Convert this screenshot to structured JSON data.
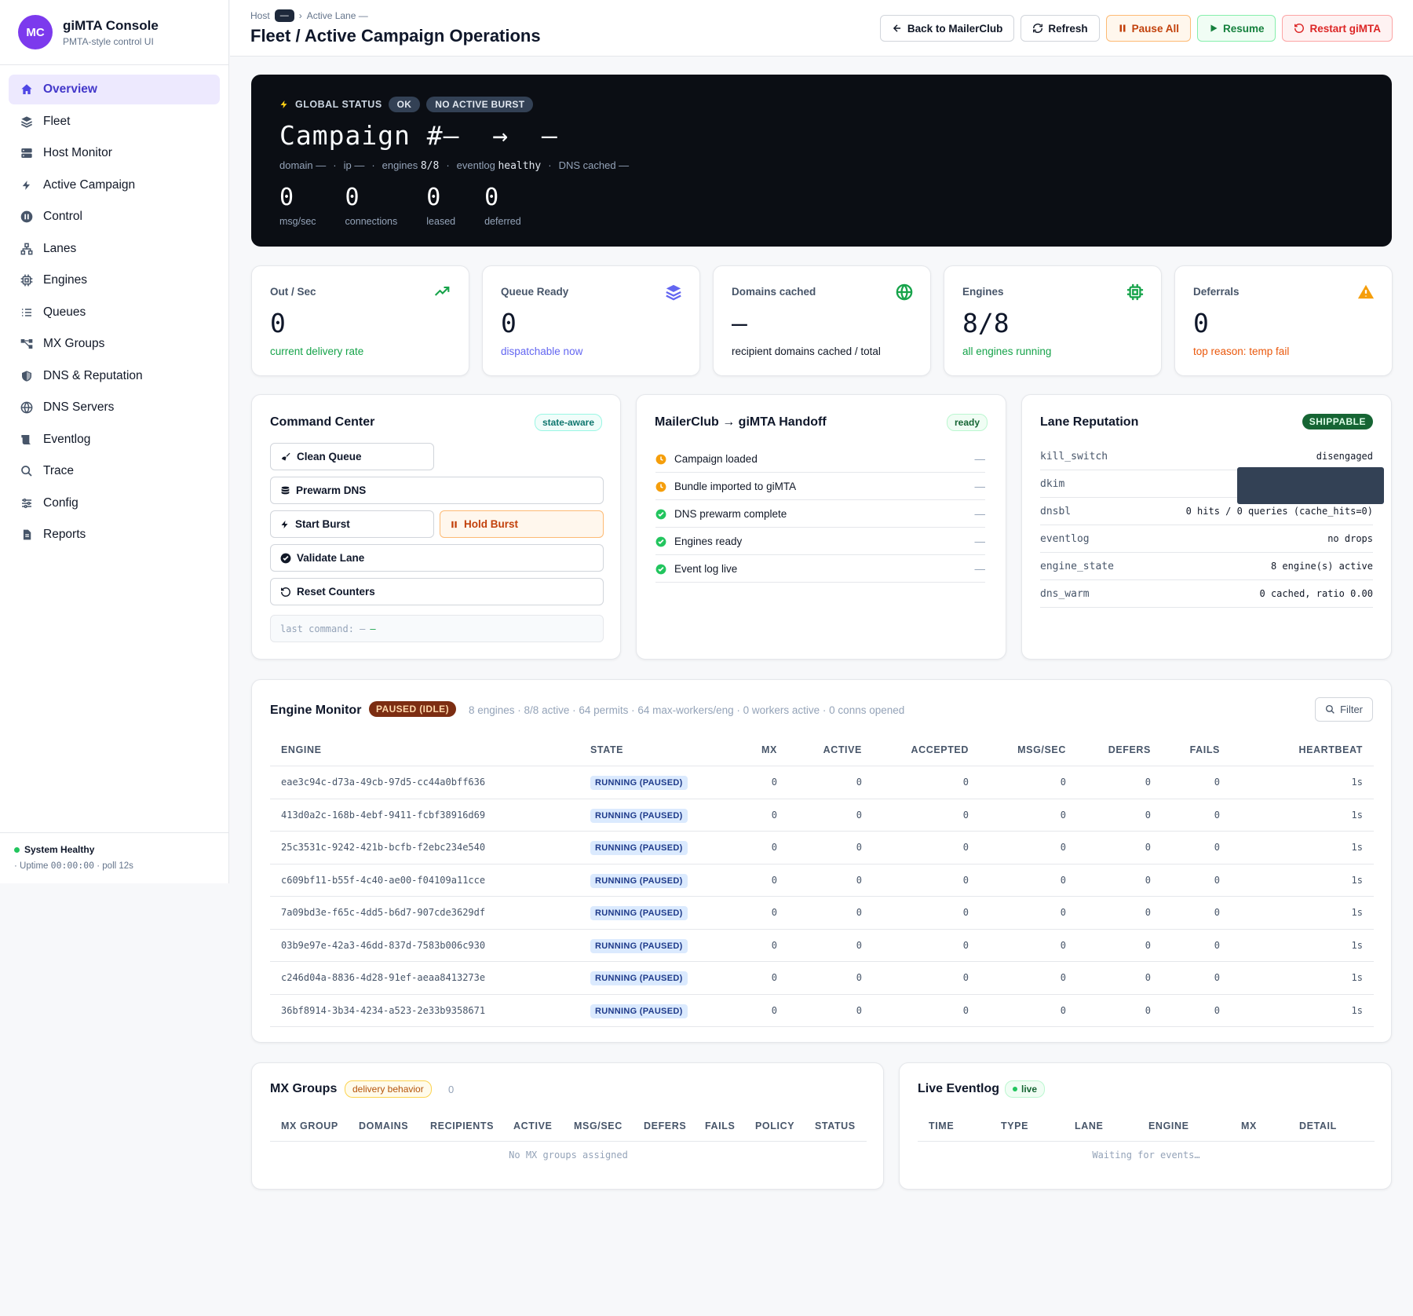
{
  "brand": {
    "initials": "MC",
    "title": "giMTA Console",
    "subtitle": "PMTA-style control UI"
  },
  "nav": [
    {
      "label": "Overview",
      "icon": "home-icon",
      "active": true
    },
    {
      "label": "Fleet",
      "icon": "layers-icon"
    },
    {
      "label": "Host Monitor",
      "icon": "server-icon"
    },
    {
      "label": "Active Campaign",
      "icon": "bolt-icon"
    },
    {
      "label": "Control",
      "icon": "pause-circle-icon"
    },
    {
      "label": "Lanes",
      "icon": "network-icon"
    },
    {
      "label": "Engines",
      "icon": "chip-icon"
    },
    {
      "label": "Queues",
      "icon": "list-icon"
    },
    {
      "label": "MX Groups",
      "icon": "share-icon"
    },
    {
      "label": "DNS & Reputation",
      "icon": "shield-icon"
    },
    {
      "label": "DNS Servers",
      "icon": "globe-icon"
    },
    {
      "label": "Eventlog",
      "icon": "scroll-icon"
    },
    {
      "label": "Trace",
      "icon": "search-icon"
    },
    {
      "label": "Config",
      "icon": "sliders-icon"
    },
    {
      "label": "Reports",
      "icon": "file-icon"
    }
  ],
  "system": {
    "status": "System Healthy",
    "uptime_prefix": "· Uptime",
    "uptime": "00:00:00",
    "poll": "· poll 12s"
  },
  "breadcrumb": {
    "host": "Host",
    "host_value": "—",
    "sep": "›",
    "lane": "Active Lane —"
  },
  "page_title": "Fleet / Active Campaign Operations",
  "actions": {
    "back": "Back to MailerClub",
    "refresh": "Refresh",
    "pause": "Pause All",
    "resume": "Resume",
    "restart": "Restart giMTA"
  },
  "hero": {
    "label": "GLOBAL STATUS",
    "status": "OK",
    "burst": "NO ACTIVE BURST",
    "title": "Campaign #—  →  —",
    "meta": {
      "domain": "domain —",
      "ip": "ip —",
      "engines_label": "engines",
      "engines": "8/8",
      "eventlog_label": "eventlog",
      "eventlog": "healthy",
      "dns": "DNS cached —"
    },
    "stats": [
      {
        "value": "0",
        "label": "msg/sec"
      },
      {
        "value": "0",
        "label": "connections"
      },
      {
        "value": "0",
        "label": "leased"
      },
      {
        "value": "0",
        "label": "deferred"
      }
    ]
  },
  "cards": [
    {
      "title": "Out / Sec",
      "value": "0",
      "sub": "current delivery rate",
      "color": "#16a34a",
      "icon": "trending-up-icon"
    },
    {
      "title": "Queue Ready",
      "value": "0",
      "sub": "dispatchable now",
      "color": "#6366f1",
      "icon": "stack-icon"
    },
    {
      "title": "Domains cached",
      "value": "—",
      "sub": "recipient domains cached / total",
      "color": "#111827",
      "icon": "globe-icon"
    },
    {
      "title": "Engines",
      "value": "8/8",
      "sub": "all engines running",
      "color": "#16a34a",
      "icon": "chip-icon"
    },
    {
      "title": "Deferrals",
      "value": "0",
      "sub": "top reason: temp fail",
      "color": "#ea580c",
      "icon": "warning-icon"
    }
  ],
  "command": {
    "title": "Command Center",
    "badge": "state-aware",
    "clean": "Clean Queue",
    "prewarm": "Prewarm DNS",
    "start": "Start Burst",
    "hold": "Hold Burst",
    "validate": "Validate Lane",
    "reset": "Reset Counters",
    "last": "last command: —",
    "last_flag": "—"
  },
  "handoff": {
    "title": "MailerClub → giMTA Handoff",
    "badge": "ready",
    "steps": [
      {
        "label": "Campaign loaded",
        "state": "pending",
        "value": "—"
      },
      {
        "label": "Bundle imported to giMTA",
        "state": "pending",
        "value": "—"
      },
      {
        "label": "DNS prewarm complete",
        "state": "done",
        "value": "—"
      },
      {
        "label": "Engines ready",
        "state": "done",
        "value": "—"
      },
      {
        "label": "Event log live",
        "state": "done",
        "value": "—"
      }
    ]
  },
  "reputation": {
    "title": "Lane Reputation",
    "badge": "SHIPPABLE",
    "rows": [
      {
        "key": "kill_switch",
        "value": "disengaged"
      },
      {
        "key": "dkim",
        "value": ""
      },
      {
        "key": "dnsbl",
        "value": "0 hits / 0 queries (cache_hits=0)"
      },
      {
        "key": "eventlog",
        "value": "no drops"
      },
      {
        "key": "engine_state",
        "value": "8 engine(s) active"
      },
      {
        "key": "dns_warm",
        "value": "0 cached, ratio 0.00"
      }
    ]
  },
  "engine_monitor": {
    "title": "Engine Monitor",
    "badge": "PAUSED (IDLE)",
    "summary": "8 engines · 8/8 active · 64 permits · 64 max-workers/eng · 0 workers active · 0 conns opened",
    "filter": "Filter",
    "columns": [
      "ENGINE",
      "STATE",
      "MX",
      "ACTIVE",
      "ACCEPTED",
      "MSG/SEC",
      "DEFERS",
      "FAILS",
      "HEARTBEAT"
    ],
    "rows": [
      {
        "id": "eae3c94c-d73a-49cb-97d5-cc44a0bff636",
        "state": "RUNNING (PAUSED)",
        "mx": "0",
        "active": "0",
        "accepted": "0",
        "rate": "0",
        "defers": "0",
        "fails": "0",
        "hb": "1s"
      },
      {
        "id": "413d0a2c-168b-4ebf-9411-fcbf38916d69",
        "state": "RUNNING (PAUSED)",
        "mx": "0",
        "active": "0",
        "accepted": "0",
        "rate": "0",
        "defers": "0",
        "fails": "0",
        "hb": "1s"
      },
      {
        "id": "25c3531c-9242-421b-bcfb-f2ebc234e540",
        "state": "RUNNING (PAUSED)",
        "mx": "0",
        "active": "0",
        "accepted": "0",
        "rate": "0",
        "defers": "0",
        "fails": "0",
        "hb": "1s"
      },
      {
        "id": "c609bf11-b55f-4c40-ae00-f04109a11cce",
        "state": "RUNNING (PAUSED)",
        "mx": "0",
        "active": "0",
        "accepted": "0",
        "rate": "0",
        "defers": "0",
        "fails": "0",
        "hb": "1s"
      },
      {
        "id": "7a09bd3e-f65c-4dd5-b6d7-907cde3629df",
        "state": "RUNNING (PAUSED)",
        "mx": "0",
        "active": "0",
        "accepted": "0",
        "rate": "0",
        "defers": "0",
        "fails": "0",
        "hb": "1s"
      },
      {
        "id": "03b9e97e-42a3-46dd-837d-7583b006c930",
        "state": "RUNNING (PAUSED)",
        "mx": "0",
        "active": "0",
        "accepted": "0",
        "rate": "0",
        "defers": "0",
        "fails": "0",
        "hb": "1s"
      },
      {
        "id": "c246d04a-8836-4d28-91ef-aeaa8413273e",
        "state": "RUNNING (PAUSED)",
        "mx": "0",
        "active": "0",
        "accepted": "0",
        "rate": "0",
        "defers": "0",
        "fails": "0",
        "hb": "1s"
      },
      {
        "id": "36bf8914-3b34-4234-a523-2e33b9358671",
        "state": "RUNNING (PAUSED)",
        "mx": "0",
        "active": "0",
        "accepted": "0",
        "rate": "0",
        "defers": "0",
        "fails": "0",
        "hb": "1s"
      }
    ]
  },
  "mx_groups": {
    "title": "MX Groups",
    "badge": "delivery behavior",
    "count": "0",
    "columns": [
      "MX GROUP",
      "DOMAINS",
      "RECIPIENTS",
      "ACTIVE",
      "MSG/SEC",
      "DEFERS",
      "FAILS",
      "POLICY",
      "STATUS"
    ],
    "empty": "No MX groups assigned"
  },
  "eventlog": {
    "title": "Live Eventlog",
    "badge": "live",
    "columns": [
      "TIME",
      "TYPE",
      "LANE",
      "ENGINE",
      "MX",
      "DETAIL"
    ],
    "empty": "Waiting for events…"
  }
}
